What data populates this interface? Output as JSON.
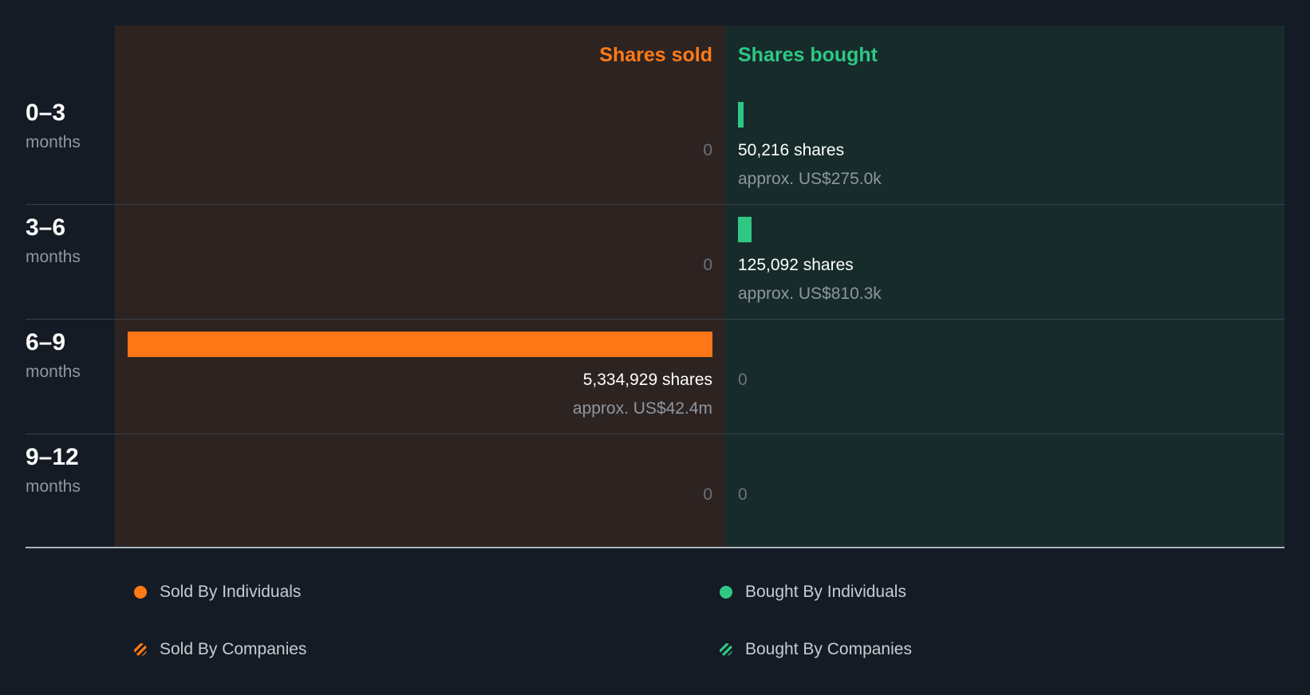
{
  "chart_data": {
    "type": "bar",
    "columns": {
      "sold": "Shares sold",
      "bought": "Shares bought"
    },
    "rows": [
      {
        "range": "0–3",
        "unit": "months",
        "sold": 0,
        "sold_label": "0",
        "sold_approx": "",
        "bought": 50216,
        "bought_label": "50,216 shares",
        "bought_approx": "approx. US$275.0k"
      },
      {
        "range": "3–6",
        "unit": "months",
        "sold": 0,
        "sold_label": "0",
        "sold_approx": "",
        "bought": 125092,
        "bought_label": "125,092 shares",
        "bought_approx": "approx. US$810.3k"
      },
      {
        "range": "6–9",
        "unit": "months",
        "sold": 5334929,
        "sold_label": "5,334,929 shares",
        "sold_approx": "approx. US$42.4m",
        "bought": 0,
        "bought_label": "0",
        "bought_approx": ""
      },
      {
        "range": "9–12",
        "unit": "months",
        "sold": 0,
        "sold_label": "0",
        "sold_approx": "",
        "bought": 0,
        "bought_label": "0",
        "bought_approx": ""
      }
    ],
    "legend": [
      {
        "label": "Sold By Individuals",
        "color": "#ff7a17",
        "style": "solid"
      },
      {
        "label": "Bought By Individuals",
        "color": "#2fc784",
        "style": "solid"
      },
      {
        "label": "Sold By Companies",
        "color": "#ff7a17",
        "style": "hatched"
      },
      {
        "label": "Bought By Companies",
        "color": "#2fc784",
        "style": "hatched"
      }
    ],
    "colors": {
      "sold": "#ff7617",
      "bought": "#2fc784",
      "background": "#151b24"
    }
  }
}
